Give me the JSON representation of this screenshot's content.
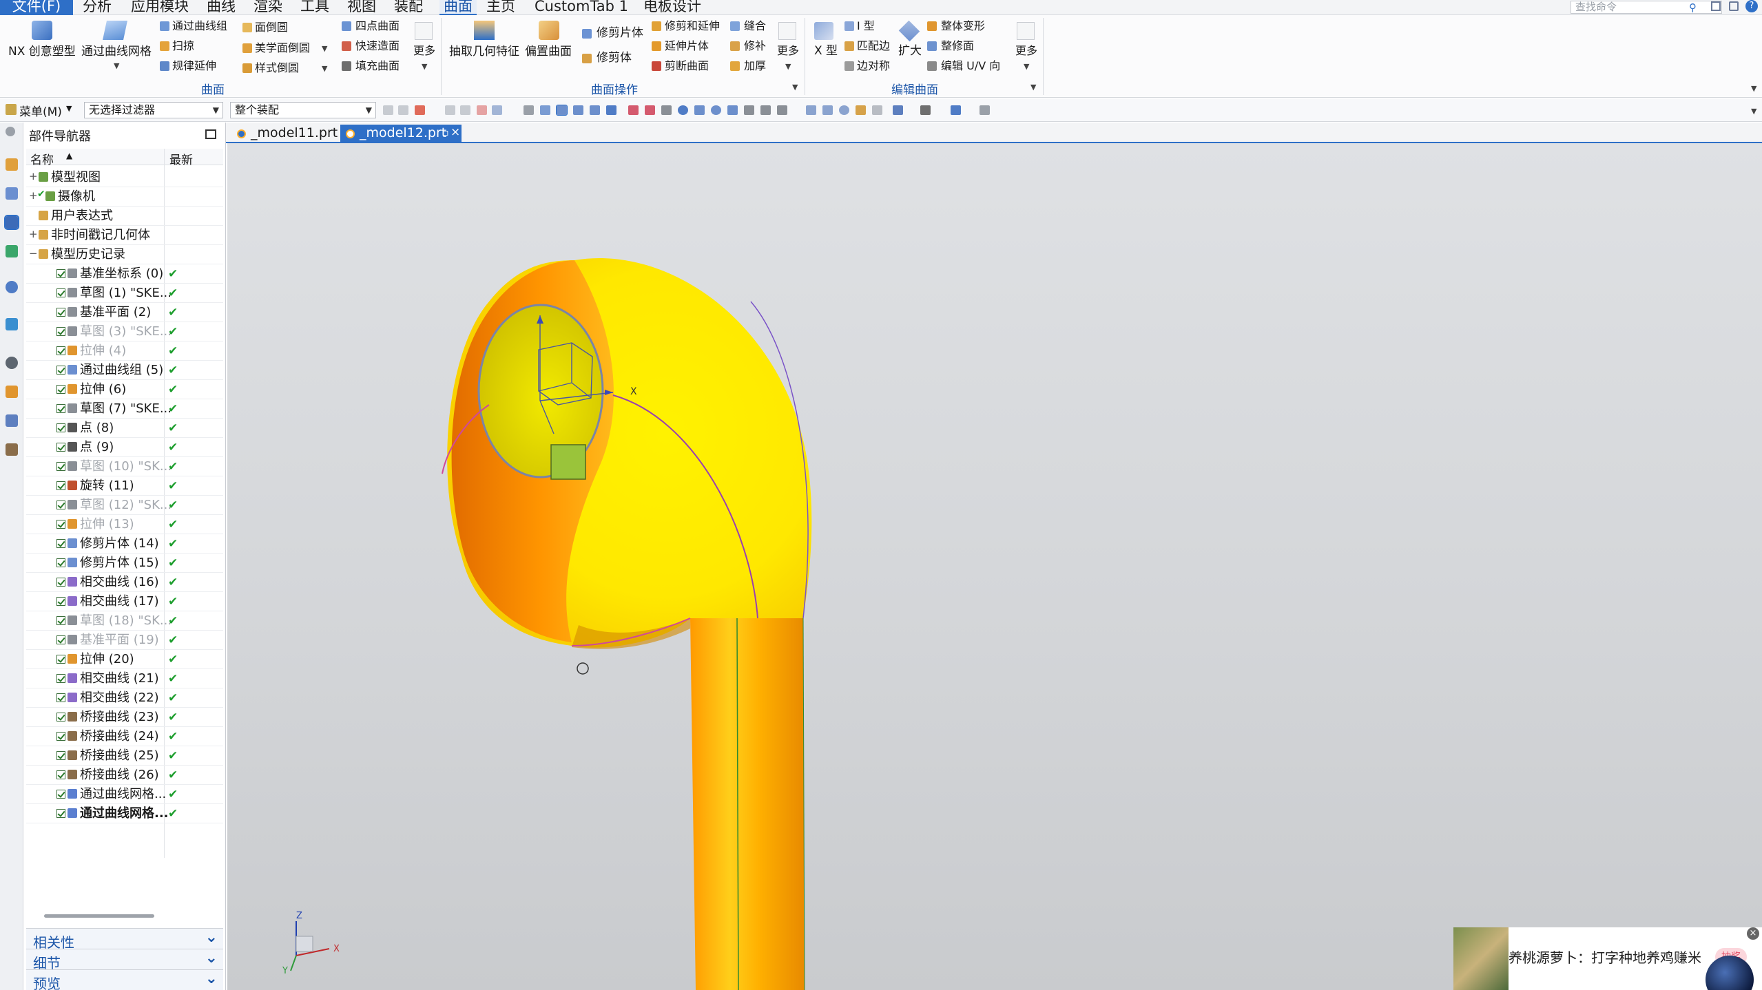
{
  "menubar": {
    "file": "文件(F)",
    "items": [
      "分析",
      "应用模块",
      "曲线",
      "渲染",
      "工具",
      "视图",
      "装配",
      "曲面",
      "主页",
      "CustomTab 1",
      "电板设计"
    ],
    "search_placeholder": "查找命令"
  },
  "ribbon": {
    "nx_creative": "NX 创意塑型",
    "thru_curve_mesh": "通过曲线网格",
    "thru_curve_group": "通过曲线组",
    "sweep": "扫掠",
    "rule_extend": "规律延伸",
    "face_blend": "面倒圆",
    "aesthetic_blend": "美学面倒圆",
    "style_blend": "样式倒圆",
    "four_point": "四点曲面",
    "quick_surface": "快速造面",
    "fill_surface": "填充曲面",
    "more1": "更多",
    "group_surface": "曲面",
    "extract_geom": "抽取几何特征",
    "offset_surface": "偏置曲面",
    "trim_sheet": "修剪片体",
    "trim_body": "修剪体",
    "trim_extend": "修剪和延伸",
    "extend_sheet": "延伸片体",
    "cut_surface": "剪断曲面",
    "sew": "缝合",
    "patch": "修补",
    "thicken": "加厚",
    "more2": "更多",
    "group_surface_ops": "曲面操作",
    "x_form": "X 型",
    "i_form": "I 型",
    "match_edge": "匹配边",
    "edge_symmetric": "边对称",
    "enlarge": "扩大",
    "global_shape": "整体变形",
    "refit_face": "整修面",
    "edit_uv": "编辑 U/V 向",
    "more3": "更多",
    "group_edit_surface": "编辑曲面"
  },
  "toolbar2": {
    "menu": "菜单(M)",
    "filter": "无选择过滤器",
    "assembly": "整个装配"
  },
  "navigator": {
    "title": "部件导航器",
    "col_name": "名称",
    "col_latest": "最新",
    "top_nodes": [
      "模型视图",
      "摄像机",
      "用户表达式",
      "非时间戳记几何体",
      "模型历史记录"
    ],
    "history": [
      {
        "label": "基准坐标系 (0)",
        "active": true,
        "ok": true
      },
      {
        "label": "草图 (1) \"SKE...",
        "active": true,
        "ok": true
      },
      {
        "label": "基准平面 (2)",
        "active": true,
        "ok": true
      },
      {
        "label": "草图 (3) \"SKE...",
        "active": false,
        "ok": true
      },
      {
        "label": "拉伸 (4)",
        "active": false,
        "ok": true
      },
      {
        "label": "通过曲线组 (5)",
        "active": true,
        "ok": true
      },
      {
        "label": "拉伸 (6)",
        "active": true,
        "ok": true
      },
      {
        "label": "草图 (7) \"SKE...",
        "active": true,
        "ok": true
      },
      {
        "label": "点 (8)",
        "active": true,
        "ok": true
      },
      {
        "label": "点 (9)",
        "active": true,
        "ok": true
      },
      {
        "label": "草图 (10) \"SK...",
        "active": false,
        "ok": true
      },
      {
        "label": "旋转 (11)",
        "active": true,
        "ok": true
      },
      {
        "label": "草图 (12) \"SK...",
        "active": false,
        "ok": true
      },
      {
        "label": "拉伸 (13)",
        "active": false,
        "ok": true
      },
      {
        "label": "修剪片体 (14)",
        "active": true,
        "ok": true
      },
      {
        "label": "修剪片体 (15)",
        "active": true,
        "ok": true
      },
      {
        "label": "相交曲线 (16)",
        "active": true,
        "ok": true
      },
      {
        "label": "相交曲线 (17)",
        "active": true,
        "ok": true
      },
      {
        "label": "草图 (18) \"SK...",
        "active": false,
        "ok": true
      },
      {
        "label": "基准平面 (19)",
        "active": false,
        "ok": true
      },
      {
        "label": "拉伸 (20)",
        "active": true,
        "ok": true
      },
      {
        "label": "相交曲线 (21)",
        "active": true,
        "ok": true
      },
      {
        "label": "相交曲线 (22)",
        "active": true,
        "ok": true
      },
      {
        "label": "桥接曲线 (23)",
        "active": true,
        "ok": true
      },
      {
        "label": "桥接曲线 (24)",
        "active": true,
        "ok": true
      },
      {
        "label": "桥接曲线 (25)",
        "active": true,
        "ok": true
      },
      {
        "label": "桥接曲线 (26)",
        "active": true,
        "ok": true
      },
      {
        "label": "通过曲线网格...",
        "active": true,
        "ok": true
      },
      {
        "label": "通过曲线网格...",
        "active": true,
        "ok": true,
        "current": true
      }
    ],
    "panels": [
      "相关性",
      "细节",
      "预览"
    ]
  },
  "tabs": [
    "_model11.prt",
    "_model12.prt"
  ],
  "triad": {
    "x": "X",
    "y": "Y",
    "z": "Z"
  },
  "notification": {
    "text": "养桃源萝卜：打字种地养鸡赚米",
    "badge": "抽奖"
  },
  "colors": {
    "accent": "#2e6fc7",
    "model_yellow": "#ffe600",
    "model_orange": "#ff9a00",
    "ok_green": "#1e9e2e"
  }
}
